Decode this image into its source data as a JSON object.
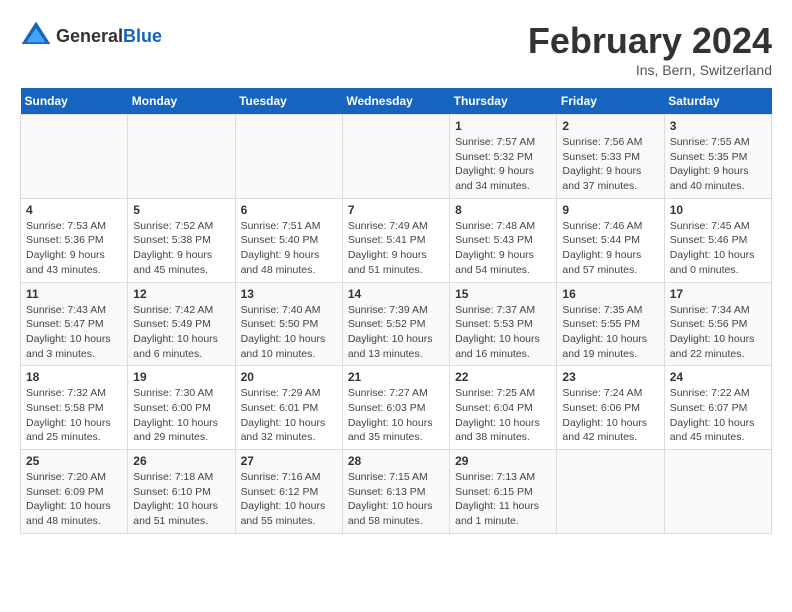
{
  "header": {
    "logo_general": "General",
    "logo_blue": "Blue",
    "title": "February 2024",
    "subtitle": "Ins, Bern, Switzerland"
  },
  "calendar": {
    "days_of_week": [
      "Sunday",
      "Monday",
      "Tuesday",
      "Wednesday",
      "Thursday",
      "Friday",
      "Saturday"
    ],
    "weeks": [
      [
        {
          "day": "",
          "info": ""
        },
        {
          "day": "",
          "info": ""
        },
        {
          "day": "",
          "info": ""
        },
        {
          "day": "",
          "info": ""
        },
        {
          "day": "1",
          "info": "Sunrise: 7:57 AM\nSunset: 5:32 PM\nDaylight: 9 hours and 34 minutes."
        },
        {
          "day": "2",
          "info": "Sunrise: 7:56 AM\nSunset: 5:33 PM\nDaylight: 9 hours and 37 minutes."
        },
        {
          "day": "3",
          "info": "Sunrise: 7:55 AM\nSunset: 5:35 PM\nDaylight: 9 hours and 40 minutes."
        }
      ],
      [
        {
          "day": "4",
          "info": "Sunrise: 7:53 AM\nSunset: 5:36 PM\nDaylight: 9 hours and 43 minutes."
        },
        {
          "day": "5",
          "info": "Sunrise: 7:52 AM\nSunset: 5:38 PM\nDaylight: 9 hours and 45 minutes."
        },
        {
          "day": "6",
          "info": "Sunrise: 7:51 AM\nSunset: 5:40 PM\nDaylight: 9 hours and 48 minutes."
        },
        {
          "day": "7",
          "info": "Sunrise: 7:49 AM\nSunset: 5:41 PM\nDaylight: 9 hours and 51 minutes."
        },
        {
          "day": "8",
          "info": "Sunrise: 7:48 AM\nSunset: 5:43 PM\nDaylight: 9 hours and 54 minutes."
        },
        {
          "day": "9",
          "info": "Sunrise: 7:46 AM\nSunset: 5:44 PM\nDaylight: 9 hours and 57 minutes."
        },
        {
          "day": "10",
          "info": "Sunrise: 7:45 AM\nSunset: 5:46 PM\nDaylight: 10 hours and 0 minutes."
        }
      ],
      [
        {
          "day": "11",
          "info": "Sunrise: 7:43 AM\nSunset: 5:47 PM\nDaylight: 10 hours and 3 minutes."
        },
        {
          "day": "12",
          "info": "Sunrise: 7:42 AM\nSunset: 5:49 PM\nDaylight: 10 hours and 6 minutes."
        },
        {
          "day": "13",
          "info": "Sunrise: 7:40 AM\nSunset: 5:50 PM\nDaylight: 10 hours and 10 minutes."
        },
        {
          "day": "14",
          "info": "Sunrise: 7:39 AM\nSunset: 5:52 PM\nDaylight: 10 hours and 13 minutes."
        },
        {
          "day": "15",
          "info": "Sunrise: 7:37 AM\nSunset: 5:53 PM\nDaylight: 10 hours and 16 minutes."
        },
        {
          "day": "16",
          "info": "Sunrise: 7:35 AM\nSunset: 5:55 PM\nDaylight: 10 hours and 19 minutes."
        },
        {
          "day": "17",
          "info": "Sunrise: 7:34 AM\nSunset: 5:56 PM\nDaylight: 10 hours and 22 minutes."
        }
      ],
      [
        {
          "day": "18",
          "info": "Sunrise: 7:32 AM\nSunset: 5:58 PM\nDaylight: 10 hours and 25 minutes."
        },
        {
          "day": "19",
          "info": "Sunrise: 7:30 AM\nSunset: 6:00 PM\nDaylight: 10 hours and 29 minutes."
        },
        {
          "day": "20",
          "info": "Sunrise: 7:29 AM\nSunset: 6:01 PM\nDaylight: 10 hours and 32 minutes."
        },
        {
          "day": "21",
          "info": "Sunrise: 7:27 AM\nSunset: 6:03 PM\nDaylight: 10 hours and 35 minutes."
        },
        {
          "day": "22",
          "info": "Sunrise: 7:25 AM\nSunset: 6:04 PM\nDaylight: 10 hours and 38 minutes."
        },
        {
          "day": "23",
          "info": "Sunrise: 7:24 AM\nSunset: 6:06 PM\nDaylight: 10 hours and 42 minutes."
        },
        {
          "day": "24",
          "info": "Sunrise: 7:22 AM\nSunset: 6:07 PM\nDaylight: 10 hours and 45 minutes."
        }
      ],
      [
        {
          "day": "25",
          "info": "Sunrise: 7:20 AM\nSunset: 6:09 PM\nDaylight: 10 hours and 48 minutes."
        },
        {
          "day": "26",
          "info": "Sunrise: 7:18 AM\nSunset: 6:10 PM\nDaylight: 10 hours and 51 minutes."
        },
        {
          "day": "27",
          "info": "Sunrise: 7:16 AM\nSunset: 6:12 PM\nDaylight: 10 hours and 55 minutes."
        },
        {
          "day": "28",
          "info": "Sunrise: 7:15 AM\nSunset: 6:13 PM\nDaylight: 10 hours and 58 minutes."
        },
        {
          "day": "29",
          "info": "Sunrise: 7:13 AM\nSunset: 6:15 PM\nDaylight: 11 hours and 1 minute."
        },
        {
          "day": "",
          "info": ""
        },
        {
          "day": "",
          "info": ""
        }
      ]
    ]
  }
}
